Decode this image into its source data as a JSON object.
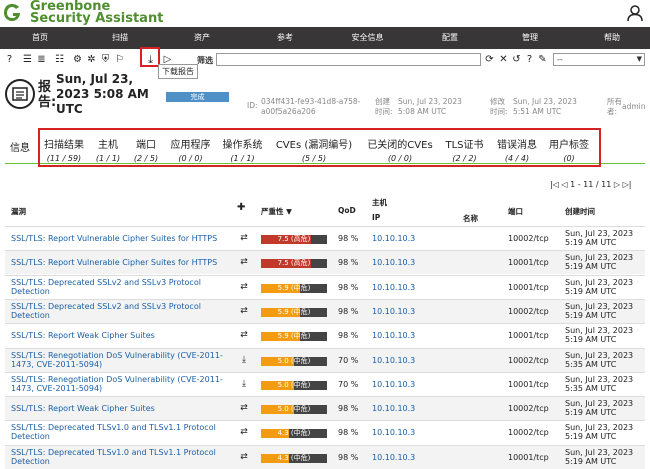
{
  "header": {
    "brand_line1": "Greenbone",
    "brand_line2": "Security Assistant"
  },
  "nav": {
    "items": [
      "首页",
      "扫描",
      "资产",
      "参考",
      "安全信息",
      "配置",
      "管理",
      "帮助"
    ]
  },
  "toolbar": {
    "tooltip": "下载报告",
    "filter_label": "筛选",
    "filter_value": "",
    "select_value": "--"
  },
  "report": {
    "label": "报告:",
    "date_title": "Sun, Jul 23, 2023 5:08 AM UTC",
    "status": "完成",
    "id_label": "ID:",
    "id_value": "034ff431-fe93-41d8-a758-a00f5a26a206",
    "created_label": "创建",
    "created_label2": "时间:",
    "created_value": "Sun, Jul 23, 2023 5:08 AM UTC",
    "modified_label": "修改",
    "modified_label2": "时间:",
    "modified_value": "Sun, Jul 23, 2023 5:51 AM UTC",
    "owner_label": "所有",
    "owner_label2": "者:",
    "owner_value": "admin"
  },
  "tabs": [
    {
      "label": "信息",
      "count": ""
    },
    {
      "label": "扫描结果",
      "count": "(11 / 59)"
    },
    {
      "label": "主机",
      "count": "(1 / 1)"
    },
    {
      "label": "端口",
      "count": "(2 / 5)"
    },
    {
      "label": "应用程序",
      "count": "(0 / 0)"
    },
    {
      "label": "操作系统",
      "count": "(1 / 1)"
    },
    {
      "label": "CVEs (漏洞编号)",
      "count": "(5 / 5)"
    },
    {
      "label": "已关闭的CVEs",
      "count": "(0 / 0)"
    },
    {
      "label": "TLS证书",
      "count": "(2 / 2)"
    },
    {
      "label": "错误消息",
      "count": "(4 / 4)"
    },
    {
      "label": "用户标签",
      "count": "(0)"
    }
  ],
  "pager": {
    "text": "1 - 11 / 11"
  },
  "columns": {
    "vuln": "漏洞",
    "severity": "严重性 ▼",
    "qod": "QoD",
    "host": "主机",
    "ip": "IP",
    "name": "名称",
    "port": "端口",
    "created": "创建时间"
  },
  "rows": [
    {
      "vuln": "SSL/TLS: Report Vulnerable Cipher Suites for HTTPS",
      "icon": "⇄",
      "sev": "7.5 (高危)",
      "sev_value": 7.5,
      "color": "#c0392b",
      "qod": "98 %",
      "ip": "10.10.10.3",
      "port": "10002/tcp",
      "date": "Sun, Jul 23, 2023 5:19 AM UTC"
    },
    {
      "vuln": "SSL/TLS: Report Vulnerable Cipher Suites for HTTPS",
      "icon": "⇄",
      "sev": "7.5 (高危)",
      "sev_value": 7.5,
      "color": "#c0392b",
      "qod": "98 %",
      "ip": "10.10.10.3",
      "port": "10001/tcp",
      "date": "Sun, Jul 23, 2023 5:19 AM UTC"
    },
    {
      "vuln": "SSL/TLS: Deprecated SSLv2 and SSLv3 Protocol Detection",
      "icon": "⇄",
      "sev": "5.9 (中危)",
      "sev_value": 5.9,
      "color": "#f39c12",
      "qod": "98 %",
      "ip": "10.10.10.3",
      "port": "10001/tcp",
      "date": "Sun, Jul 23, 2023 5:19 AM UTC"
    },
    {
      "vuln": "SSL/TLS: Deprecated SSLv2 and SSLv3 Protocol Detection",
      "icon": "⇄",
      "sev": "5.9 (中危)",
      "sev_value": 5.9,
      "color": "#f39c12",
      "qod": "98 %",
      "ip": "10.10.10.3",
      "port": "10002/tcp",
      "date": "Sun, Jul 23, 2023 5:19 AM UTC"
    },
    {
      "vuln": "SSL/TLS: Report Weak Cipher Suites",
      "icon": "⇄",
      "sev": "5.9 (中危)",
      "sev_value": 5.9,
      "color": "#f39c12",
      "qod": "98 %",
      "ip": "10.10.10.3",
      "port": "10001/tcp",
      "date": "Sun, Jul 23, 2023 5:19 AM UTC"
    },
    {
      "vuln": "SSL/TLS: Renegotiation DoS Vulnerability (CVE-2011-1473, CVE-2011-5094)",
      "icon": "⤓",
      "sev": "5.0 (中危)",
      "sev_value": 5.0,
      "color": "#f39c12",
      "qod": "70 %",
      "ip": "10.10.10.3",
      "port": "10002/tcp",
      "date": "Sun, Jul 23, 2023 5:35 AM UTC"
    },
    {
      "vuln": "SSL/TLS: Renegotiation DoS Vulnerability (CVE-2011-1473, CVE-2011-5094)",
      "icon": "⤓",
      "sev": "5.0 (中危)",
      "sev_value": 5.0,
      "color": "#f39c12",
      "qod": "70 %",
      "ip": "10.10.10.3",
      "port": "10001/tcp",
      "date": "Sun, Jul 23, 2023 5:35 AM UTC"
    },
    {
      "vuln": "SSL/TLS: Report Weak Cipher Suites",
      "icon": "⇄",
      "sev": "5.0 (中危)",
      "sev_value": 5.0,
      "color": "#f39c12",
      "qod": "98 %",
      "ip": "10.10.10.3",
      "port": "10002/tcp",
      "date": "Sun, Jul 23, 2023 5:19 AM UTC"
    },
    {
      "vuln": "SSL/TLS: Deprecated TLSv1.0 and TLSv1.1 Protocol Detection",
      "icon": "⇄",
      "sev": "4.3 (中危)",
      "sev_value": 4.3,
      "color": "#f39c12",
      "qod": "98 %",
      "ip": "10.10.10.3",
      "port": "10002/tcp",
      "date": "Sun, Jul 23, 2023 5:19 AM UTC"
    },
    {
      "vuln": "SSL/TLS: Deprecated TLSv1.0 and TLSv1.1 Protocol Detection",
      "icon": "⇄",
      "sev": "4.3 (中危)",
      "sev_value": 4.3,
      "color": "#f39c12",
      "qod": "98 %",
      "ip": "10.10.10.3",
      "port": "10001/tcp",
      "date": "Sun, Jul 23, 2023 5:19 AM UTC"
    }
  ]
}
